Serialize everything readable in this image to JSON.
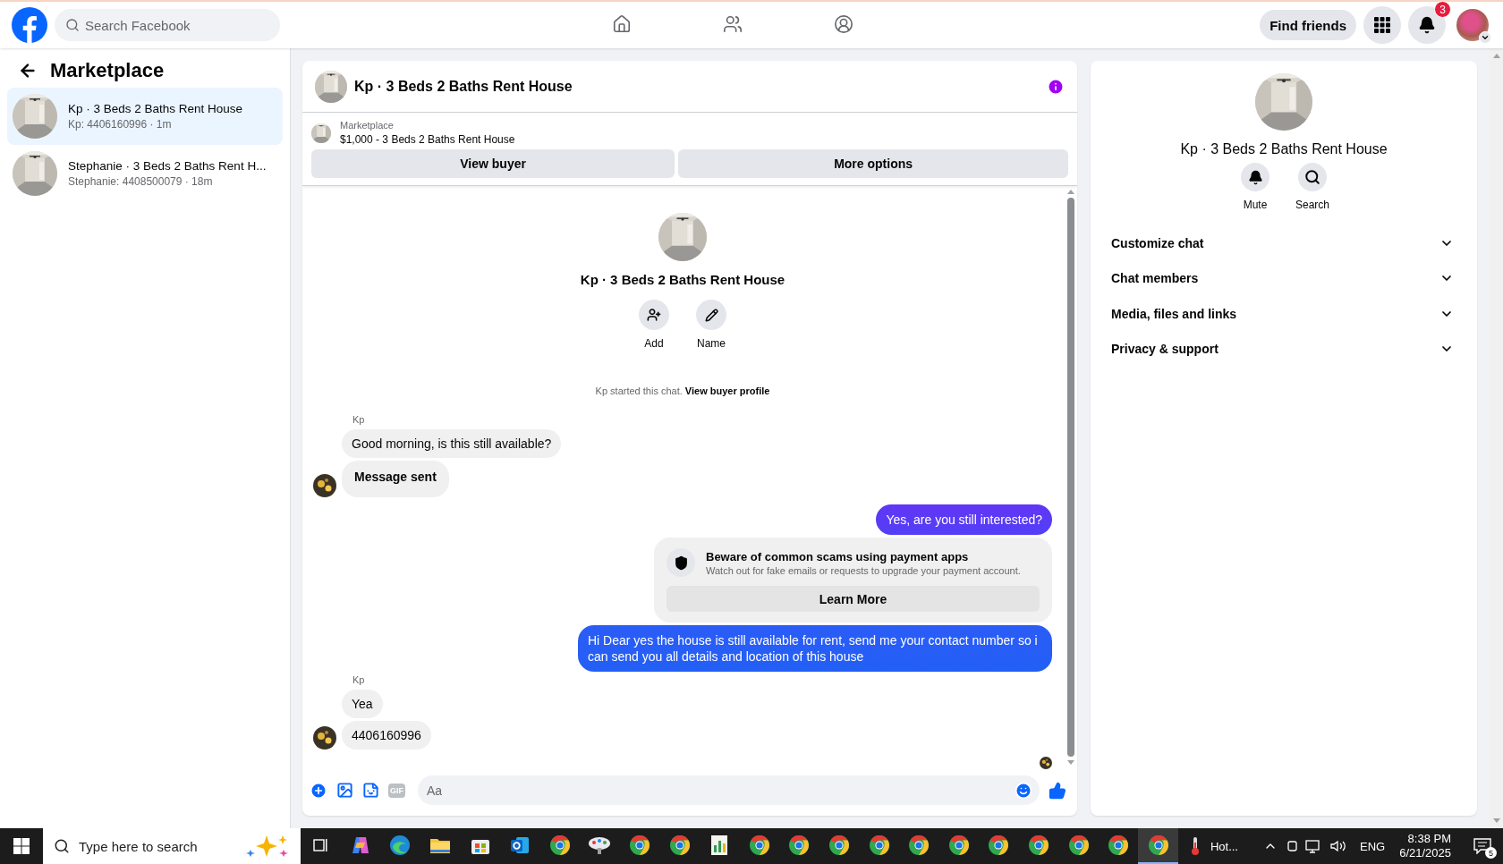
{
  "topbar": {
    "search": {
      "placeholder": "Search Facebook"
    },
    "nav": [
      {
        "kind": "home",
        "selected": false
      },
      {
        "kind": "friends",
        "selected": false
      },
      {
        "kind": "groups",
        "selected": false
      }
    ],
    "find_friends": "Find friends",
    "notifications_badge": "3"
  },
  "sidebar": {
    "title": "Marketplace",
    "conversations": [
      {
        "title": "Kp · 3 Beds 2 Baths Rent House",
        "subtitle": "Kp: 4406160996 · 1m",
        "selected": true
      },
      {
        "title": "Stephanie · 3 Beds 2 Baths Rent H...",
        "subtitle": "Stephanie: 4408500079 · 18m",
        "selected": false
      }
    ]
  },
  "chat": {
    "title": "Kp · 3 Beds 2 Baths Rent House",
    "listing": {
      "label": "Marketplace",
      "text": "$1,000 - 3 Beds 2 Baths Rent House"
    },
    "buttons": [
      "View buyer",
      "More options"
    ],
    "intro": {
      "title": "Kp · 3 Beds 2 Baths Rent House",
      "actions": [
        {
          "kind": "add",
          "label": "Add"
        },
        {
          "kind": "rename",
          "label": "Name"
        }
      ],
      "notice": "Kp started this chat.",
      "notice_link": "View buyer profile"
    },
    "messages": [
      {
        "kind": "incoming",
        "sender": "Kp",
        "bubbles": [
          {
            "kind": "text",
            "text": "Good morning, is this still available?"
          },
          {
            "kind": "status",
            "text": "Message sent"
          }
        ]
      },
      {
        "kind": "outgoing",
        "text": "Yes, are you still interested?"
      },
      {
        "kind": "warning",
        "title": "Beware of common scams using payment apps",
        "text": "Watch out for fake emails or requests to upgrade your payment account.",
        "button": "Learn More"
      },
      {
        "kind": "outgoing",
        "text": "Hi Dear yes the house is still available for rent, send me your contact number so i can send you all details and location of this house"
      },
      {
        "kind": "incoming",
        "sender": "Kp",
        "bubbles": [
          {
            "kind": "text",
            "text": "Yea"
          },
          {
            "kind": "text",
            "text": "4406160996"
          }
        ]
      }
    ],
    "composer": {
      "gif": "GIF",
      "placeholder": "Aa"
    }
  },
  "details": {
    "title": "Kp · 3 Beds 2 Baths Rent House",
    "actions": [
      {
        "kind": "mute",
        "label": "Mute"
      },
      {
        "kind": "search",
        "label": "Search"
      }
    ],
    "sections": [
      {
        "label": "Customize chat",
        "expanded": false
      },
      {
        "label": "Chat members",
        "expanded": false
      },
      {
        "label": "Media, files and links",
        "expanded": false
      },
      {
        "label": "Privacy & support",
        "expanded": false
      }
    ]
  },
  "taskbar": {
    "search": {
      "placeholder": "Type here to search"
    },
    "apps": [
      {
        "kind": "taskview",
        "selected": false
      },
      {
        "kind": "copilot",
        "selected": false
      },
      {
        "kind": "edge",
        "selected": false
      },
      {
        "kind": "explorer",
        "selected": false
      },
      {
        "kind": "store",
        "selected": false
      },
      {
        "kind": "outlook",
        "selected": false
      },
      {
        "kind": "chrome",
        "selected": false
      },
      {
        "kind": "paint",
        "selected": false
      },
      {
        "kind": "chrome",
        "selected": false
      },
      {
        "kind": "chrome",
        "selected": false
      },
      {
        "kind": "sheets",
        "selected": false
      },
      {
        "kind": "chrome",
        "selected": false
      },
      {
        "kind": "chrome",
        "selected": false
      },
      {
        "kind": "chrome",
        "selected": false
      },
      {
        "kind": "chrome",
        "selected": false
      },
      {
        "kind": "chrome",
        "selected": false
      },
      {
        "kind": "chrome",
        "selected": false
      },
      {
        "kind": "chrome",
        "selected": false
      },
      {
        "kind": "chrome",
        "selected": false
      },
      {
        "kind": "chrome",
        "selected": false
      },
      {
        "kind": "chrome",
        "selected": false
      },
      {
        "kind": "chrome",
        "selected": true
      }
    ],
    "weather": "Hot...",
    "language": "ENG",
    "time": "8:38 PM",
    "date": "6/21/2025",
    "notification_count": "5"
  }
}
